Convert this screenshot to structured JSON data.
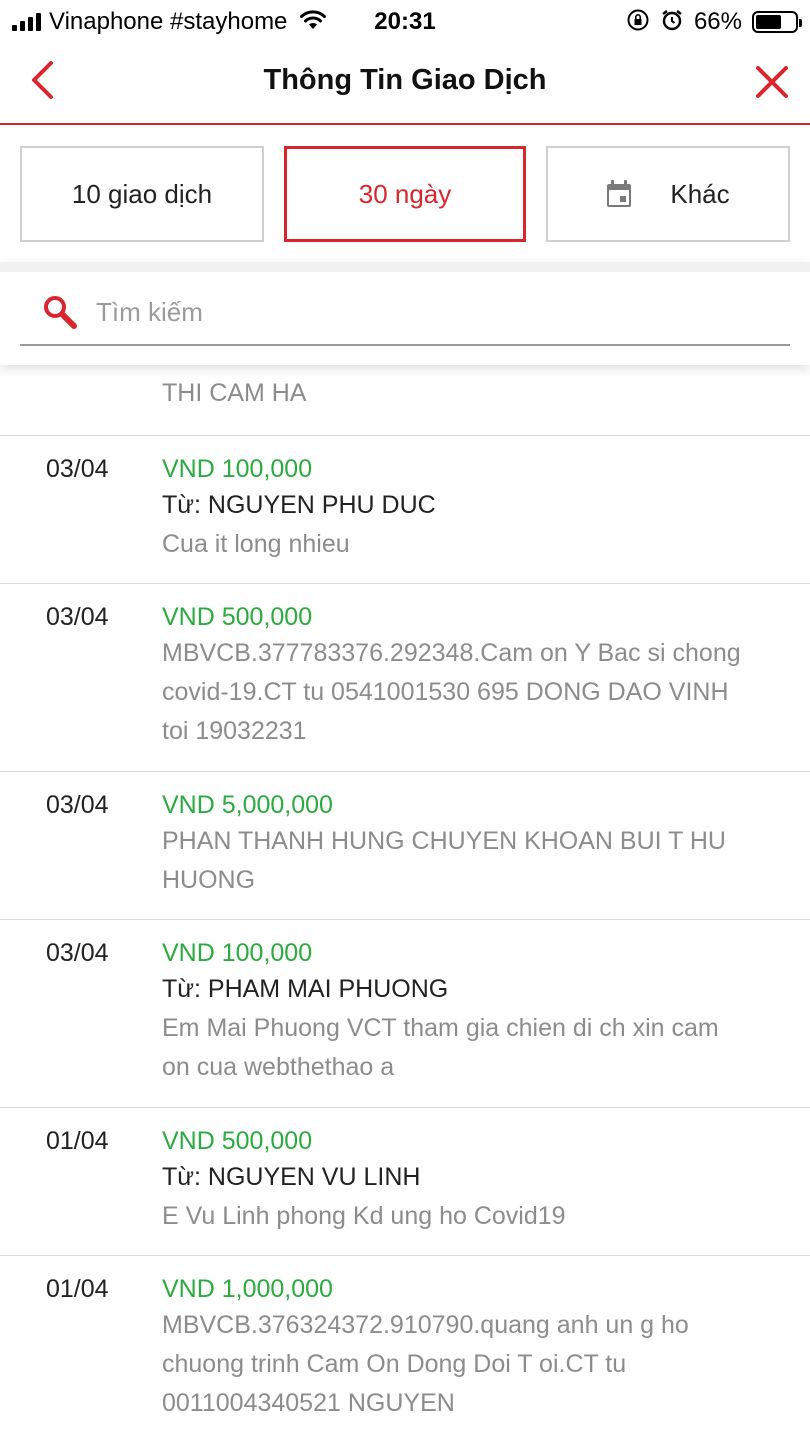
{
  "status_bar": {
    "carrier": "Vinaphone #stayhome",
    "time": "20:31",
    "battery": "66%",
    "battery_level": 0.66
  },
  "header": {
    "title": "Thông Tin Giao Dịch"
  },
  "filters": {
    "tab_10": "10 giao dịch",
    "tab_30": "30 ngày",
    "tab_other": "Khác",
    "active": "30 ngày"
  },
  "search": {
    "placeholder": "Tìm kiếm"
  },
  "transactions": {
    "partial_desc": "THI CAM HA",
    "items": [
      {
        "date": "03/04",
        "amount": "VND 100,000",
        "from": "Từ: NGUYEN PHU DUC",
        "desc": "Cua it long nhieu"
      },
      {
        "date": "03/04",
        "amount": "VND 500,000",
        "desc1": "MBVCB.377783376.292348.Cam on Y Bac si chong",
        "desc2": "covid-19.CT tu 0541001530 695 DONG DAO VINH",
        "desc3": "toi 19032231"
      },
      {
        "date": "03/04",
        "amount": "VND 5,000,000",
        "desc1": "PHAN THANH HUNG CHUYEN KHOAN BUI T HU",
        "desc2": "HUONG"
      },
      {
        "date": "03/04",
        "amount": "VND 100,000",
        "from": "Từ: PHAM MAI PHUONG",
        "desc1": "Em Mai Phuong VCT tham gia chien di ch xin cam",
        "desc2": "on cua webthethao a"
      },
      {
        "date": "01/04",
        "amount": "VND 500,000",
        "from": "Từ: NGUYEN VU LINH",
        "desc": "E Vu Linh phong Kd ung ho Covid19"
      },
      {
        "date": "01/04",
        "amount": "VND 1,000,000",
        "desc1": "MBVCB.376324372.910790.quang anh un g ho",
        "desc2": "chuong trinh Cam On Dong Doi T oi.CT tu",
        "desc3": "0011004340521 NGUYEN"
      }
    ]
  },
  "colors": {
    "accent": "#d9262e",
    "amount": "#2bab3f",
    "muted_text": "#8c8c8c"
  },
  "icons": {
    "back": "chevron-left-icon",
    "close": "close-icon",
    "calendar": "calendar-icon",
    "search": "search-icon",
    "wifi": "wifi-icon",
    "rotation_lock": "rotation-lock-icon",
    "alarm": "alarm-icon",
    "battery": "battery-icon"
  }
}
